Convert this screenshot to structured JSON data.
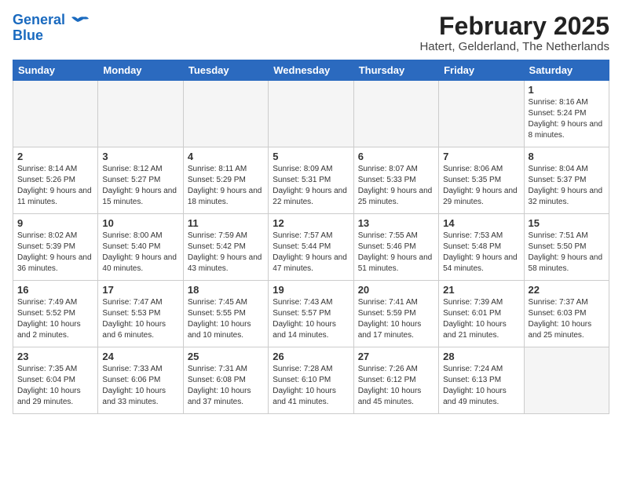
{
  "header": {
    "logo_line1": "General",
    "logo_line2": "Blue",
    "month_year": "February 2025",
    "location": "Hatert, Gelderland, The Netherlands"
  },
  "weekdays": [
    "Sunday",
    "Monday",
    "Tuesday",
    "Wednesday",
    "Thursday",
    "Friday",
    "Saturday"
  ],
  "weeks": [
    [
      {
        "day": "",
        "info": ""
      },
      {
        "day": "",
        "info": ""
      },
      {
        "day": "",
        "info": ""
      },
      {
        "day": "",
        "info": ""
      },
      {
        "day": "",
        "info": ""
      },
      {
        "day": "",
        "info": ""
      },
      {
        "day": "1",
        "info": "Sunrise: 8:16 AM\nSunset: 5:24 PM\nDaylight: 9 hours and 8 minutes."
      }
    ],
    [
      {
        "day": "2",
        "info": "Sunrise: 8:14 AM\nSunset: 5:26 PM\nDaylight: 9 hours and 11 minutes."
      },
      {
        "day": "3",
        "info": "Sunrise: 8:12 AM\nSunset: 5:27 PM\nDaylight: 9 hours and 15 minutes."
      },
      {
        "day": "4",
        "info": "Sunrise: 8:11 AM\nSunset: 5:29 PM\nDaylight: 9 hours and 18 minutes."
      },
      {
        "day": "5",
        "info": "Sunrise: 8:09 AM\nSunset: 5:31 PM\nDaylight: 9 hours and 22 minutes."
      },
      {
        "day": "6",
        "info": "Sunrise: 8:07 AM\nSunset: 5:33 PM\nDaylight: 9 hours and 25 minutes."
      },
      {
        "day": "7",
        "info": "Sunrise: 8:06 AM\nSunset: 5:35 PM\nDaylight: 9 hours and 29 minutes."
      },
      {
        "day": "8",
        "info": "Sunrise: 8:04 AM\nSunset: 5:37 PM\nDaylight: 9 hours and 32 minutes."
      }
    ],
    [
      {
        "day": "9",
        "info": "Sunrise: 8:02 AM\nSunset: 5:39 PM\nDaylight: 9 hours and 36 minutes."
      },
      {
        "day": "10",
        "info": "Sunrise: 8:00 AM\nSunset: 5:40 PM\nDaylight: 9 hours and 40 minutes."
      },
      {
        "day": "11",
        "info": "Sunrise: 7:59 AM\nSunset: 5:42 PM\nDaylight: 9 hours and 43 minutes."
      },
      {
        "day": "12",
        "info": "Sunrise: 7:57 AM\nSunset: 5:44 PM\nDaylight: 9 hours and 47 minutes."
      },
      {
        "day": "13",
        "info": "Sunrise: 7:55 AM\nSunset: 5:46 PM\nDaylight: 9 hours and 51 minutes."
      },
      {
        "day": "14",
        "info": "Sunrise: 7:53 AM\nSunset: 5:48 PM\nDaylight: 9 hours and 54 minutes."
      },
      {
        "day": "15",
        "info": "Sunrise: 7:51 AM\nSunset: 5:50 PM\nDaylight: 9 hours and 58 minutes."
      }
    ],
    [
      {
        "day": "16",
        "info": "Sunrise: 7:49 AM\nSunset: 5:52 PM\nDaylight: 10 hours and 2 minutes."
      },
      {
        "day": "17",
        "info": "Sunrise: 7:47 AM\nSunset: 5:53 PM\nDaylight: 10 hours and 6 minutes."
      },
      {
        "day": "18",
        "info": "Sunrise: 7:45 AM\nSunset: 5:55 PM\nDaylight: 10 hours and 10 minutes."
      },
      {
        "day": "19",
        "info": "Sunrise: 7:43 AM\nSunset: 5:57 PM\nDaylight: 10 hours and 14 minutes."
      },
      {
        "day": "20",
        "info": "Sunrise: 7:41 AM\nSunset: 5:59 PM\nDaylight: 10 hours and 17 minutes."
      },
      {
        "day": "21",
        "info": "Sunrise: 7:39 AM\nSunset: 6:01 PM\nDaylight: 10 hours and 21 minutes."
      },
      {
        "day": "22",
        "info": "Sunrise: 7:37 AM\nSunset: 6:03 PM\nDaylight: 10 hours and 25 minutes."
      }
    ],
    [
      {
        "day": "23",
        "info": "Sunrise: 7:35 AM\nSunset: 6:04 PM\nDaylight: 10 hours and 29 minutes."
      },
      {
        "day": "24",
        "info": "Sunrise: 7:33 AM\nSunset: 6:06 PM\nDaylight: 10 hours and 33 minutes."
      },
      {
        "day": "25",
        "info": "Sunrise: 7:31 AM\nSunset: 6:08 PM\nDaylight: 10 hours and 37 minutes."
      },
      {
        "day": "26",
        "info": "Sunrise: 7:28 AM\nSunset: 6:10 PM\nDaylight: 10 hours and 41 minutes."
      },
      {
        "day": "27",
        "info": "Sunrise: 7:26 AM\nSunset: 6:12 PM\nDaylight: 10 hours and 45 minutes."
      },
      {
        "day": "28",
        "info": "Sunrise: 7:24 AM\nSunset: 6:13 PM\nDaylight: 10 hours and 49 minutes."
      },
      {
        "day": "",
        "info": ""
      }
    ]
  ]
}
